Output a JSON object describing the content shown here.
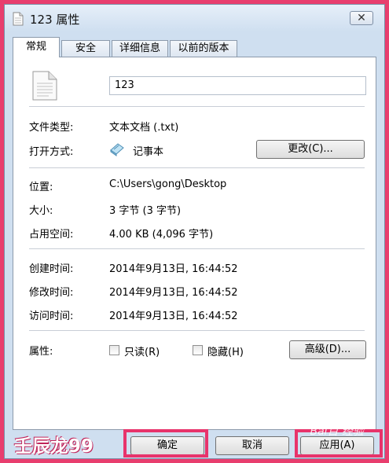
{
  "window": {
    "title": "123 属性",
    "close_glyph": "✕"
  },
  "tabs": [
    {
      "label": "常规",
      "active": true
    },
    {
      "label": "安全",
      "active": false
    },
    {
      "label": "详细信息",
      "active": false
    },
    {
      "label": "以前的版本",
      "active": false
    }
  ],
  "general": {
    "file_name": "123",
    "type_label": "文件类型:",
    "type_value": "文本文档 (.txt)",
    "open_with_label": "打开方式:",
    "open_with_value": "记事本",
    "change_button": "更改(C)...",
    "location_label": "位置:",
    "location_value": "C:\\Users\\gong\\Desktop",
    "size_label": "大小:",
    "size_value": "3 字节 (3 字节)",
    "size_on_disk_label": "占用空间:",
    "size_on_disk_value": "4.00 KB (4,096 字节)",
    "created_label": "创建时间:",
    "created_value": "2014年9月13日, 16:44:52",
    "modified_label": "修改时间:",
    "modified_value": "2014年9月13日, 16:44:52",
    "accessed_label": "访问时间:",
    "accessed_value": "2014年9月13日, 16:44:52",
    "attributes_label": "属性:",
    "readonly_label": "只读(R)",
    "hidden_label": "隐藏(H)",
    "advanced_button": "高级(D)..."
  },
  "footer": {
    "ok_button": "确定",
    "cancel_button": "取消",
    "apply_button": "应用(A)"
  },
  "overlay": {
    "watermark": "壬辰龙99",
    "baidu_mark": "Bai百 经验",
    "highlight_color": "#e8336b"
  },
  "colors": {
    "frame": "#cfdff0",
    "border": "#e83e6e"
  }
}
